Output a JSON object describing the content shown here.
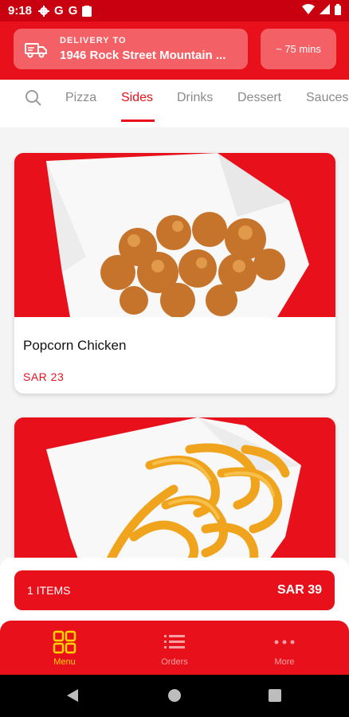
{
  "status_bar": {
    "time": "9:18",
    "left_icons": [
      "gear-icon",
      "google-icon",
      "google-icon",
      "clipboard-icon"
    ],
    "right_icons": [
      "wifi-icon",
      "signal-icon",
      "battery-icon"
    ]
  },
  "header": {
    "delivery_label": "DELIVERY TO",
    "delivery_address": "1946 Rock Street Mountain ...",
    "eta": "~ 75 mins"
  },
  "categories": {
    "items": [
      "Pizza",
      "Sides",
      "Drinks",
      "Dessert",
      "Sauces"
    ],
    "active": "Sides"
  },
  "products": [
    {
      "name": "Popcorn Chicken",
      "price": "SAR 23",
      "image": "popcorn-chicken"
    },
    {
      "name": "",
      "price": "",
      "image": "curly-fries"
    }
  ],
  "cart": {
    "count_label": "1 ITEMS",
    "total": "SAR 39"
  },
  "bottom_nav": {
    "items": [
      {
        "label": "Menu",
        "icon": "grid-icon",
        "active": true
      },
      {
        "label": "Orders",
        "icon": "list-icon",
        "active": false
      },
      {
        "label": "More",
        "icon": "more-dots-icon",
        "active": false
      }
    ]
  },
  "colors": {
    "brand_red": "#e8101b",
    "status_red": "#c8000f",
    "accent_yellow": "#ffd400",
    "pill_red": "#f36167"
  }
}
